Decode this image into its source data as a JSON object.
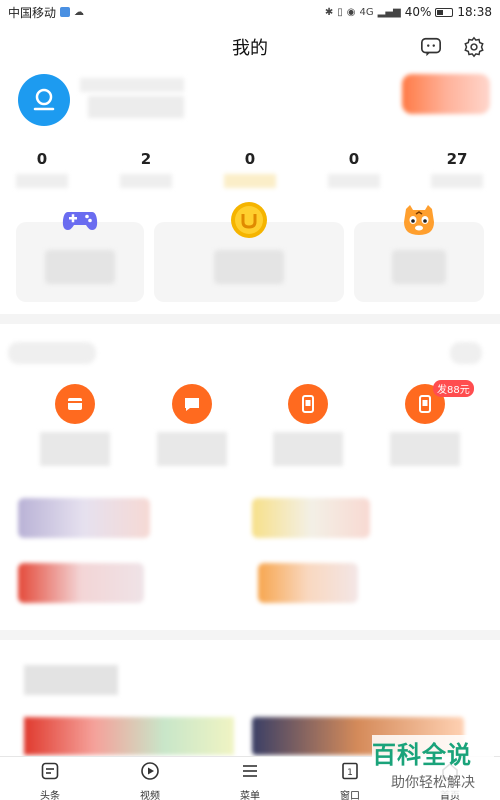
{
  "status_bar": {
    "carrier": "中国移动",
    "signal": "4G",
    "battery": "40%",
    "time": "18:38"
  },
  "header": {
    "title": "我的"
  },
  "stats": [
    {
      "value": "0"
    },
    {
      "value": "2"
    },
    {
      "value": "0"
    },
    {
      "value": "0"
    },
    {
      "value": "27"
    }
  ],
  "cards": [
    {
      "icon": "gamepad-icon"
    },
    {
      "icon": "gold-coin-icon"
    },
    {
      "icon": "tiger-icon"
    }
  ],
  "tools": [
    {
      "icon": "wallet-icon"
    },
    {
      "icon": "message-icon"
    },
    {
      "icon": "phone-card-icon"
    },
    {
      "icon": "phone-card-icon",
      "badge": "发88元"
    }
  ],
  "tabbar": {
    "items": [
      {
        "label": "头条",
        "icon": "news-icon"
      },
      {
        "label": "视频",
        "icon": "play-icon"
      },
      {
        "label": "菜单",
        "icon": "menu-icon"
      },
      {
        "label": "窗口",
        "icon": "window-icon"
      },
      {
        "label": "首页",
        "icon": "home-icon"
      }
    ]
  },
  "watermark": {
    "title": "百科全说",
    "subtitle": "助你轻松解决"
  },
  "colors": {
    "accent_blue": "#1d9bf0",
    "accent_orange": "#ff6a1f",
    "watermark_green": "#1aa37a"
  }
}
